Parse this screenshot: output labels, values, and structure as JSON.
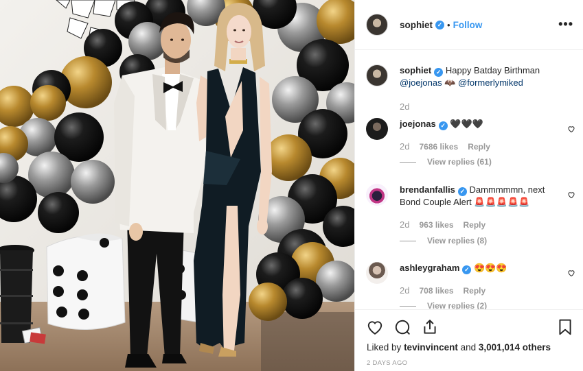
{
  "post": {
    "username": "sophiet",
    "verified_mark": "✓",
    "dot": "•",
    "follow_label": "Follow",
    "more_label": "•••",
    "caption": {
      "username": "sophiet",
      "text": "Happy Batday Birthman",
      "mention_1": "@joejonas",
      "emoji": "🦇",
      "mention_2": "@formerlymiked",
      "date": "2d"
    },
    "comments": [
      {
        "username": "joejonas",
        "text": "🖤🖤🖤",
        "date": "2d",
        "likes": "7686 likes",
        "reply": "Reply",
        "view_replies": "View replies (61)",
        "avatar": "joejonas-avatar"
      },
      {
        "username": "brendanfallis",
        "text": "Dammmmmn, next Bond Couple Alert 🚨🚨🚨🚨🚨",
        "date": "2d",
        "likes": "963 likes",
        "reply": "Reply",
        "view_replies": "View replies (8)",
        "avatar": "brendanfallis-avatar"
      },
      {
        "username": "ashleygraham",
        "text": "😍😍😍",
        "date": "2d",
        "likes": "708 likes",
        "reply": "Reply",
        "view_replies": "View replies (2)",
        "avatar": "ashleygraham-avatar"
      }
    ],
    "liked_by_prefix": "Liked by",
    "liked_by_user": "tevinvincent",
    "liked_by_suffix": "and",
    "liked_by_count": "3,001,014 others",
    "posted_time": "2 DAYS AGO"
  },
  "colors": {
    "link": "#3897f0",
    "mention": "#003569",
    "muted": "#999999",
    "text": "#262626",
    "border": "#efefef"
  },
  "icons": [
    "heart-icon",
    "comment-icon",
    "share-icon",
    "bookmark-icon",
    "more-options-icon",
    "verified-badge-icon"
  ]
}
